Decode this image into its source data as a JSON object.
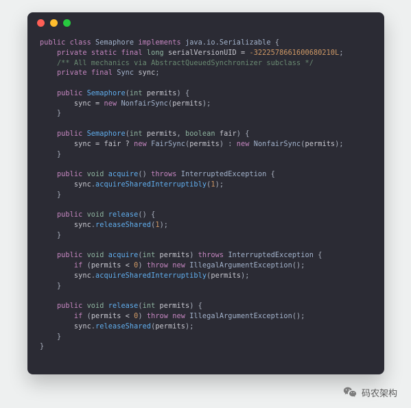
{
  "window": {
    "traffic_lights": {
      "close": "#ff5f56",
      "minimize": "#ffbd2e",
      "zoom": "#27c93f"
    }
  },
  "code": {
    "tokens": [
      [
        {
          "t": "public",
          "c": "kw"
        },
        {
          "t": " "
        },
        {
          "t": "class",
          "c": "kw"
        },
        {
          "t": " "
        },
        {
          "t": "Semaphore",
          "c": "type"
        },
        {
          "t": " "
        },
        {
          "t": "implements",
          "c": "impl"
        },
        {
          "t": " "
        },
        {
          "t": "java.io.Serializable",
          "c": "type"
        },
        {
          "t": " {",
          "c": "pn"
        }
      ],
      [
        {
          "t": "    "
        },
        {
          "t": "private",
          "c": "kw"
        },
        {
          "t": " "
        },
        {
          "t": "static",
          "c": "kw"
        },
        {
          "t": " "
        },
        {
          "t": "final",
          "c": "kw"
        },
        {
          "t": " "
        },
        {
          "t": "long",
          "c": "prm"
        },
        {
          "t": " "
        },
        {
          "t": "serialVersionUID",
          "c": "var"
        },
        {
          "t": " = ",
          "c": "op"
        },
        {
          "t": "-3222578661600680210L",
          "c": "num"
        },
        {
          "t": ";",
          "c": "pn"
        }
      ],
      [
        {
          "t": "    "
        },
        {
          "t": "/** All mechanics via AbstractQueuedSynchronizer subclass */",
          "c": "cmt"
        }
      ],
      [
        {
          "t": "    "
        },
        {
          "t": "private",
          "c": "kw"
        },
        {
          "t": " "
        },
        {
          "t": "final",
          "c": "kw"
        },
        {
          "t": " "
        },
        {
          "t": "Sync",
          "c": "type"
        },
        {
          "t": " "
        },
        {
          "t": "sync",
          "c": "var"
        },
        {
          "t": ";",
          "c": "pn"
        }
      ],
      [],
      [
        {
          "t": "    "
        },
        {
          "t": "public",
          "c": "kw"
        },
        {
          "t": " "
        },
        {
          "t": "Semaphore",
          "c": "fn"
        },
        {
          "t": "(",
          "c": "pn"
        },
        {
          "t": "int",
          "c": "prm"
        },
        {
          "t": " permits",
          "c": "var"
        },
        {
          "t": ") {",
          "c": "pn"
        }
      ],
      [
        {
          "t": "        "
        },
        {
          "t": "sync",
          "c": "var"
        },
        {
          "t": " = ",
          "c": "op"
        },
        {
          "t": "new",
          "c": "kw"
        },
        {
          "t": " "
        },
        {
          "t": "NonfairSync",
          "c": "type"
        },
        {
          "t": "(",
          "c": "pn"
        },
        {
          "t": "permits",
          "c": "var"
        },
        {
          "t": ");",
          "c": "pn"
        }
      ],
      [
        {
          "t": "    "
        },
        {
          "t": "}",
          "c": "pn"
        }
      ],
      [],
      [
        {
          "t": "    "
        },
        {
          "t": "public",
          "c": "kw"
        },
        {
          "t": " "
        },
        {
          "t": "Semaphore",
          "c": "fn"
        },
        {
          "t": "(",
          "c": "pn"
        },
        {
          "t": "int",
          "c": "prm"
        },
        {
          "t": " permits",
          "c": "var"
        },
        {
          "t": ", ",
          "c": "pn"
        },
        {
          "t": "boolean",
          "c": "prm"
        },
        {
          "t": " fair",
          "c": "var"
        },
        {
          "t": ") {",
          "c": "pn"
        }
      ],
      [
        {
          "t": "        "
        },
        {
          "t": "sync",
          "c": "var"
        },
        {
          "t": " = ",
          "c": "op"
        },
        {
          "t": "fair",
          "c": "var"
        },
        {
          "t": " ? ",
          "c": "op"
        },
        {
          "t": "new",
          "c": "kw"
        },
        {
          "t": " "
        },
        {
          "t": "FairSync",
          "c": "type"
        },
        {
          "t": "(",
          "c": "pn"
        },
        {
          "t": "permits",
          "c": "var"
        },
        {
          "t": ") : ",
          "c": "pn"
        },
        {
          "t": "new",
          "c": "kw"
        },
        {
          "t": " "
        },
        {
          "t": "NonfairSync",
          "c": "type"
        },
        {
          "t": "(",
          "c": "pn"
        },
        {
          "t": "permits",
          "c": "var"
        },
        {
          "t": ");",
          "c": "pn"
        }
      ],
      [
        {
          "t": "    "
        },
        {
          "t": "}",
          "c": "pn"
        }
      ],
      [],
      [
        {
          "t": "    "
        },
        {
          "t": "public",
          "c": "kw"
        },
        {
          "t": " "
        },
        {
          "t": "void",
          "c": "prm"
        },
        {
          "t": " "
        },
        {
          "t": "acquire",
          "c": "fn"
        },
        {
          "t": "() ",
          "c": "pn"
        },
        {
          "t": "throws",
          "c": "kw"
        },
        {
          "t": " "
        },
        {
          "t": "InterruptedException",
          "c": "type"
        },
        {
          "t": " {",
          "c": "pn"
        }
      ],
      [
        {
          "t": "        "
        },
        {
          "t": "sync",
          "c": "var"
        },
        {
          "t": ".",
          "c": "pn"
        },
        {
          "t": "acquireSharedInterruptibly",
          "c": "fn"
        },
        {
          "t": "(",
          "c": "pn"
        },
        {
          "t": "1",
          "c": "num"
        },
        {
          "t": ");",
          "c": "pn"
        }
      ],
      [
        {
          "t": "    "
        },
        {
          "t": "}",
          "c": "pn"
        }
      ],
      [],
      [
        {
          "t": "    "
        },
        {
          "t": "public",
          "c": "kw"
        },
        {
          "t": " "
        },
        {
          "t": "void",
          "c": "prm"
        },
        {
          "t": " "
        },
        {
          "t": "release",
          "c": "fn"
        },
        {
          "t": "() {",
          "c": "pn"
        }
      ],
      [
        {
          "t": "        "
        },
        {
          "t": "sync",
          "c": "var"
        },
        {
          "t": ".",
          "c": "pn"
        },
        {
          "t": "releaseShared",
          "c": "fn"
        },
        {
          "t": "(",
          "c": "pn"
        },
        {
          "t": "1",
          "c": "num"
        },
        {
          "t": ");",
          "c": "pn"
        }
      ],
      [
        {
          "t": "    "
        },
        {
          "t": "}",
          "c": "pn"
        }
      ],
      [],
      [
        {
          "t": "    "
        },
        {
          "t": "public",
          "c": "kw"
        },
        {
          "t": " "
        },
        {
          "t": "void",
          "c": "prm"
        },
        {
          "t": " "
        },
        {
          "t": "acquire",
          "c": "fn"
        },
        {
          "t": "(",
          "c": "pn"
        },
        {
          "t": "int",
          "c": "prm"
        },
        {
          "t": " permits",
          "c": "var"
        },
        {
          "t": ") ",
          "c": "pn"
        },
        {
          "t": "throws",
          "c": "kw"
        },
        {
          "t": " "
        },
        {
          "t": "InterruptedException",
          "c": "type"
        },
        {
          "t": " {",
          "c": "pn"
        }
      ],
      [
        {
          "t": "        "
        },
        {
          "t": "if",
          "c": "kw"
        },
        {
          "t": " (",
          "c": "pn"
        },
        {
          "t": "permits",
          "c": "var"
        },
        {
          "t": " < ",
          "c": "op"
        },
        {
          "t": "0",
          "c": "num"
        },
        {
          "t": ") ",
          "c": "pn"
        },
        {
          "t": "throw",
          "c": "kw"
        },
        {
          "t": " "
        },
        {
          "t": "new",
          "c": "kw"
        },
        {
          "t": " "
        },
        {
          "t": "IllegalArgumentException",
          "c": "type"
        },
        {
          "t": "();",
          "c": "pn"
        }
      ],
      [
        {
          "t": "        "
        },
        {
          "t": "sync",
          "c": "var"
        },
        {
          "t": ".",
          "c": "pn"
        },
        {
          "t": "acquireSharedInterruptibly",
          "c": "fn"
        },
        {
          "t": "(",
          "c": "pn"
        },
        {
          "t": "permits",
          "c": "var"
        },
        {
          "t": ");",
          "c": "pn"
        }
      ],
      [
        {
          "t": "    "
        },
        {
          "t": "}",
          "c": "pn"
        }
      ],
      [],
      [
        {
          "t": "    "
        },
        {
          "t": "public",
          "c": "kw"
        },
        {
          "t": " "
        },
        {
          "t": "void",
          "c": "prm"
        },
        {
          "t": " "
        },
        {
          "t": "release",
          "c": "fn"
        },
        {
          "t": "(",
          "c": "pn"
        },
        {
          "t": "int",
          "c": "prm"
        },
        {
          "t": " permits",
          "c": "var"
        },
        {
          "t": ") {",
          "c": "pn"
        }
      ],
      [
        {
          "t": "        "
        },
        {
          "t": "if",
          "c": "kw"
        },
        {
          "t": " (",
          "c": "pn"
        },
        {
          "t": "permits",
          "c": "var"
        },
        {
          "t": " < ",
          "c": "op"
        },
        {
          "t": "0",
          "c": "num"
        },
        {
          "t": ") ",
          "c": "pn"
        },
        {
          "t": "throw",
          "c": "kw"
        },
        {
          "t": " "
        },
        {
          "t": "new",
          "c": "kw"
        },
        {
          "t": " "
        },
        {
          "t": "IllegalArgumentException",
          "c": "type"
        },
        {
          "t": "();",
          "c": "pn"
        }
      ],
      [
        {
          "t": "        "
        },
        {
          "t": "sync",
          "c": "var"
        },
        {
          "t": ".",
          "c": "pn"
        },
        {
          "t": "releaseShared",
          "c": "fn"
        },
        {
          "t": "(",
          "c": "pn"
        },
        {
          "t": "permits",
          "c": "var"
        },
        {
          "t": ");",
          "c": "pn"
        }
      ],
      [
        {
          "t": "    "
        },
        {
          "t": "}",
          "c": "pn"
        }
      ],
      [
        {
          "t": "}",
          "c": "pn"
        }
      ]
    ]
  },
  "footer": {
    "label": "码农架构"
  }
}
